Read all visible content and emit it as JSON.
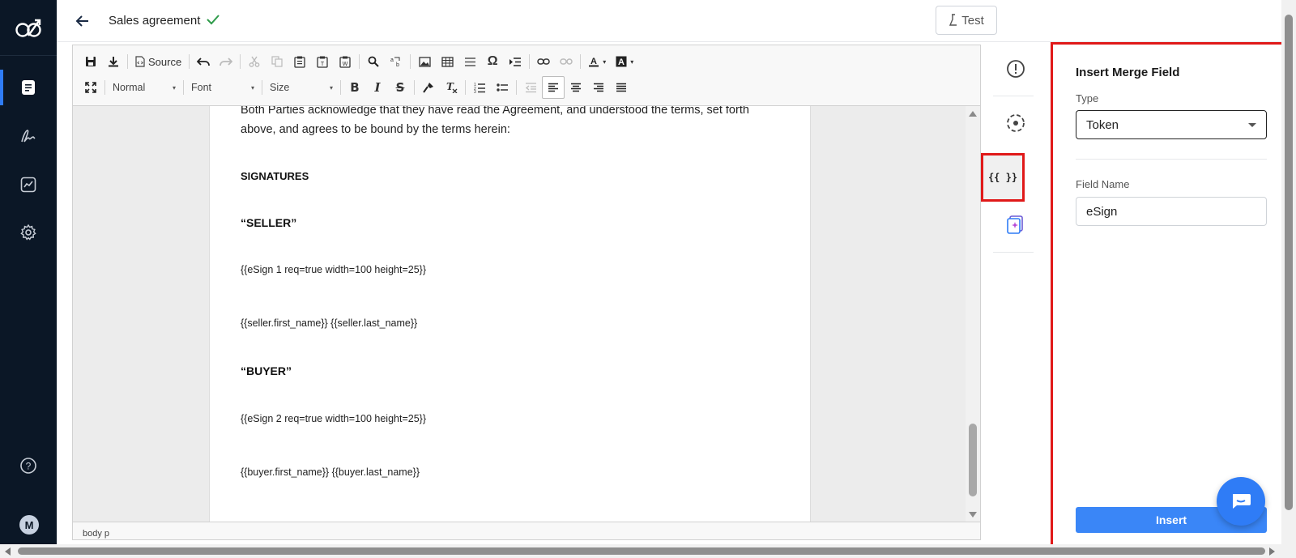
{
  "header": {
    "doc_title": "Sales agreement",
    "test_label": "Test"
  },
  "toolbar": {
    "source_label": "Source",
    "format_combo": "Normal",
    "font_combo": "Font",
    "size_combo": "Size"
  },
  "document": {
    "paragraph": "Both Parties acknowledge that they have read the Agreement, and understood the terms, set forth above, and agrees to be bound by the terms herein:",
    "signatures_heading": "SIGNATURES",
    "seller_heading": "“SELLER”",
    "seller_esign": "{{eSign 1 req=true width=100 height=25}}",
    "seller_name": "{{seller.first_name}} {{seller.last_name}}",
    "buyer_heading": "“BUYER”",
    "buyer_esign": "{{eSign 2 req=true width=100 height=25}}",
    "buyer_name": "{{buyer.first_name}} {{buyer.last_name}}"
  },
  "statusbar": {
    "path": "body   p"
  },
  "rail": {
    "merge_icon_text": "{{ }}"
  },
  "panel": {
    "title": "Insert Merge Field",
    "type_label": "Type",
    "type_value": "Token",
    "field_name_label": "Field Name",
    "field_name_value": "eSign",
    "insert_label": "Insert"
  },
  "user": {
    "avatar_initial": "M"
  },
  "colors": {
    "accent": "#3a86f7",
    "nav_bg": "#0b1726",
    "highlight_border": "#e01919",
    "check_green": "#2e9b4a"
  }
}
